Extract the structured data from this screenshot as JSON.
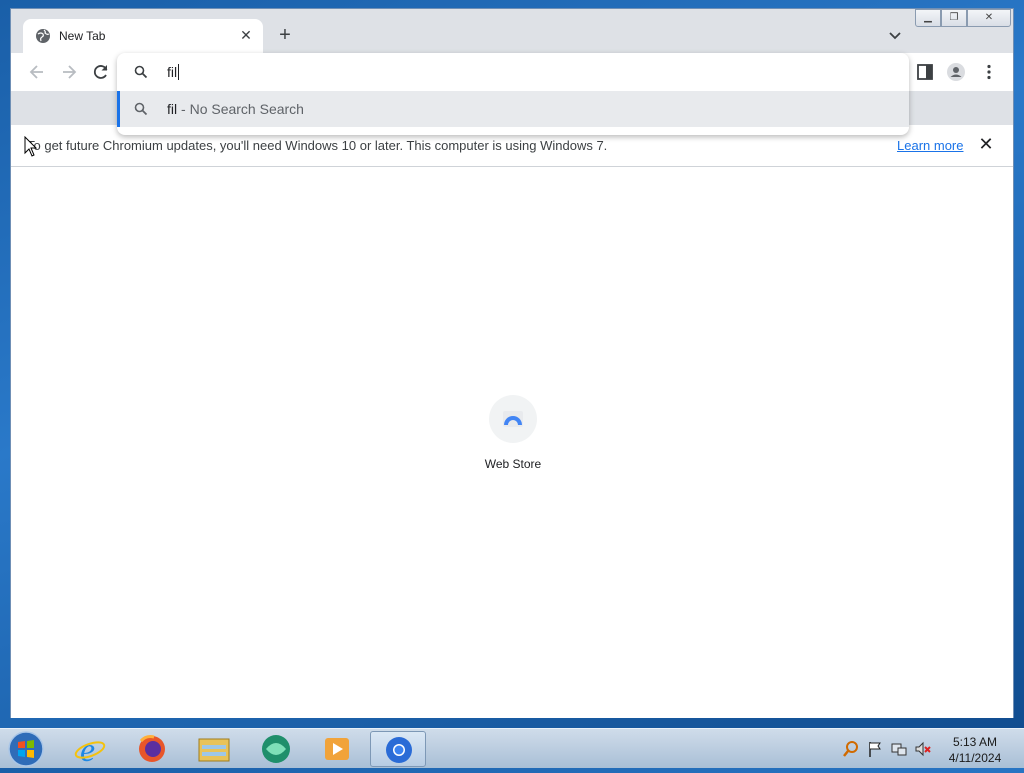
{
  "window": {
    "tab_title": "New Tab",
    "tab_icon": "globe-icon",
    "new_tab_icon": "plus-icon",
    "tab_search_icon": "chevron-down-icon"
  },
  "omnibox": {
    "query": "fil",
    "suggestion_query": "fil",
    "suggestion_separator": " - ",
    "suggestion_engine": "No Search Search"
  },
  "infobar": {
    "message": "To get future Chromium updates, you'll need Windows 10 or later. This computer is using Windows 7.",
    "link": "Learn more"
  },
  "content": {
    "shortcut_label": "Web Store"
  },
  "taskbar": {
    "apps": [
      "internet-explorer-icon",
      "firefox-icon",
      "file-explorer-icon",
      "media-app-icon",
      "media-player-icon",
      "chromium-icon"
    ],
    "time": "5:13 AM",
    "date": "4/11/2024"
  },
  "colors": {
    "accent": "#1a73e8",
    "tabstrip": "#dee1e6",
    "suggestion_bg": "#e8eaed"
  }
}
